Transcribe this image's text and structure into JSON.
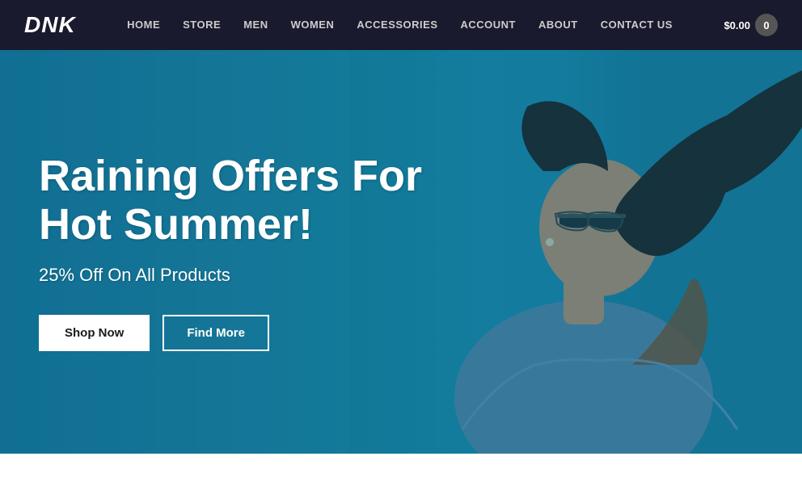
{
  "brand": {
    "logo": "DNK"
  },
  "nav": {
    "links": [
      {
        "label": "HOME",
        "href": "#"
      },
      {
        "label": "STORE",
        "href": "#"
      },
      {
        "label": "MEN",
        "href": "#"
      },
      {
        "label": "WOMEN",
        "href": "#"
      },
      {
        "label": "ACCESSORIES",
        "href": "#"
      },
      {
        "label": "ACCOUNT",
        "href": "#"
      },
      {
        "label": "ABOUT",
        "href": "#"
      },
      {
        "label": "CONTACT US",
        "href": "#"
      }
    ],
    "cart": {
      "price": "$0.00",
      "count": "0"
    }
  },
  "hero": {
    "title": "Raining Offers For Hot Summer!",
    "subtitle": "25% Off On All Products",
    "btn_shop": "Shop Now",
    "btn_find": "Find More"
  }
}
